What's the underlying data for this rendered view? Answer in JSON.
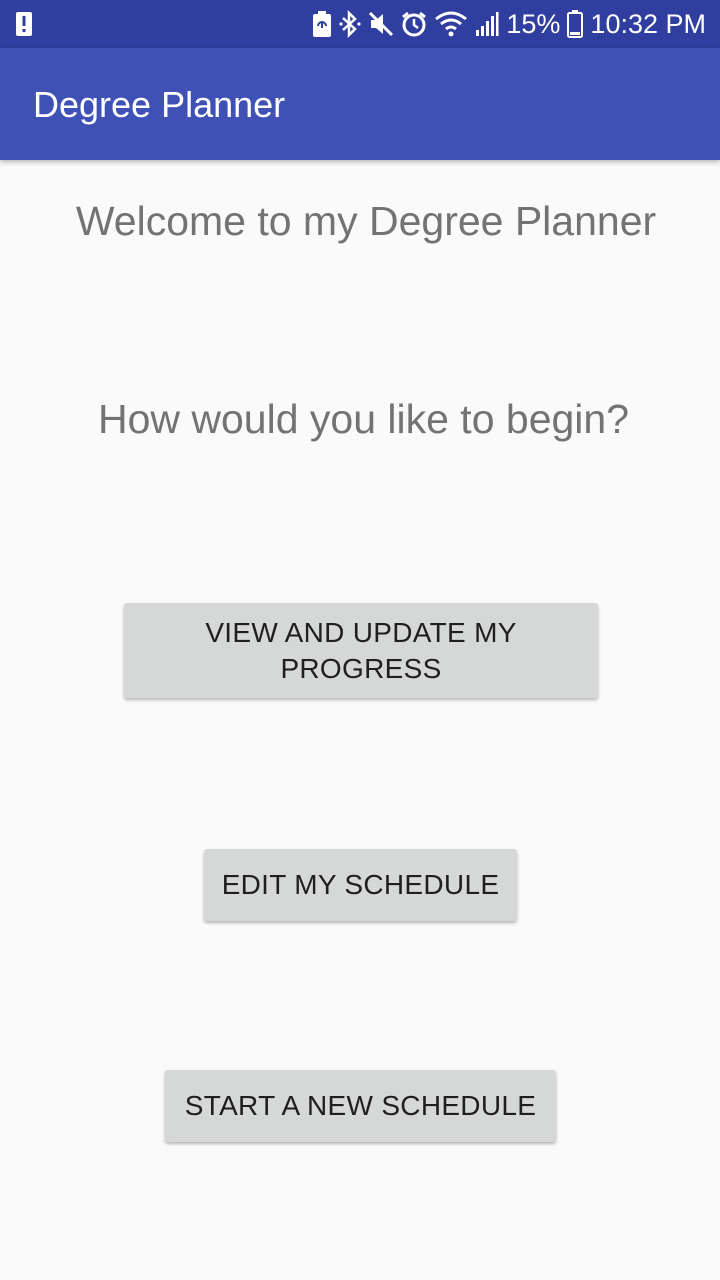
{
  "status_bar": {
    "battery_percent": "15%",
    "time": "10:32 PM",
    "icons": [
      "alert-icon",
      "battery-saver-icon",
      "bluetooth-icon",
      "mute-icon",
      "alarm-icon",
      "wifi-icon",
      "signal-icon",
      "battery-icon"
    ]
  },
  "app_bar": {
    "title": "Degree Planner",
    "color": "#3f51b5",
    "status_color": "#303f9f"
  },
  "main": {
    "welcome_text": "Welcome to my Degree Planner",
    "question_text": "How would you like to begin?",
    "buttons": [
      {
        "label": "VIEW AND UPDATE MY PROGRESS"
      },
      {
        "label": "EDIT MY SCHEDULE"
      },
      {
        "label": "START A NEW SCHEDULE"
      }
    ]
  }
}
